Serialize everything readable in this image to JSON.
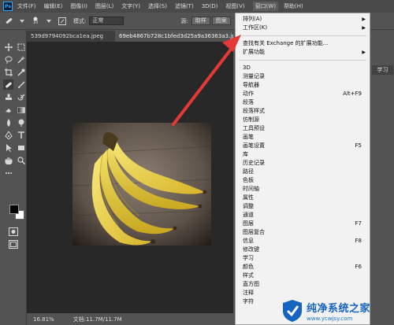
{
  "app": {
    "logo": "Ps"
  },
  "menubar": {
    "items": [
      "文件(F)",
      "编辑(E)",
      "图像(I)",
      "图层(L)",
      "文字(Y)",
      "选择(S)",
      "滤镜(T)",
      "3D(D)",
      "视图(V)",
      "窗口(W)",
      "帮助(H)"
    ]
  },
  "options": {
    "brush_size": "10",
    "mode_label": "模式:",
    "mode_value": "正常",
    "source_label": "源:",
    "sample_button": "取样",
    "pattern_button": "图案"
  },
  "tabs": [
    {
      "label": "539d9794092bca1ea.jpeg"
    },
    {
      "label": "69eb4867b728c1bfed3d25a9a36363a3.jpeg @"
    }
  ],
  "statusbar": {
    "zoom": "16.81%",
    "doc": "文档:11.7M/11.7M"
  },
  "rightpanel": {
    "tab": "学习"
  },
  "window_menu": {
    "group1": [
      {
        "label": "排列(A)",
        "submenu": true
      },
      {
        "label": "工作区(K)",
        "submenu": true
      }
    ],
    "group2": [
      {
        "label": "查找有关 Exchange 的扩展功能...",
        "submenu": false
      },
      {
        "label": "扩展功能",
        "submenu": true
      }
    ],
    "group3": [
      {
        "label": "3D",
        "shortcut": ""
      },
      {
        "label": "测量记录",
        "shortcut": ""
      },
      {
        "label": "导航器",
        "shortcut": ""
      },
      {
        "label": "动作",
        "shortcut": "Alt+F9"
      },
      {
        "label": "段落",
        "shortcut": ""
      },
      {
        "label": "段落样式",
        "shortcut": ""
      },
      {
        "label": "仿制源",
        "shortcut": ""
      },
      {
        "label": "工具预设",
        "shortcut": ""
      },
      {
        "label": "画笔",
        "shortcut": ""
      },
      {
        "label": "画笔设置",
        "shortcut": "F5"
      },
      {
        "label": "库",
        "shortcut": ""
      },
      {
        "label": "历史记录",
        "shortcut": ""
      },
      {
        "label": "路径",
        "shortcut": ""
      },
      {
        "label": "色板",
        "shortcut": ""
      },
      {
        "label": "时间轴",
        "shortcut": ""
      },
      {
        "label": "属性",
        "shortcut": ""
      },
      {
        "label": "调整",
        "shortcut": ""
      },
      {
        "label": "通道",
        "shortcut": ""
      },
      {
        "label": "图层",
        "shortcut": "F7"
      },
      {
        "label": "图层复合",
        "shortcut": ""
      },
      {
        "label": "信息",
        "shortcut": "F8"
      },
      {
        "label": "修改键",
        "shortcut": ""
      },
      {
        "label": "学习",
        "shortcut": ""
      },
      {
        "label": "颜色",
        "shortcut": "F6"
      },
      {
        "label": "样式",
        "shortcut": ""
      },
      {
        "label": "直方图",
        "shortcut": ""
      },
      {
        "label": "注释",
        "shortcut": ""
      },
      {
        "label": "字符",
        "shortcut": ""
      }
    ]
  },
  "annotation": {
    "color": "#e53935"
  },
  "watermark": {
    "title": "纯净系统之家",
    "url": "www.ycwjsy.com"
  },
  "colors": {
    "canvas": "#282828",
    "panel": "#535353",
    "menu": "#f2f2f2",
    "shield_blue": "#1565c0"
  }
}
